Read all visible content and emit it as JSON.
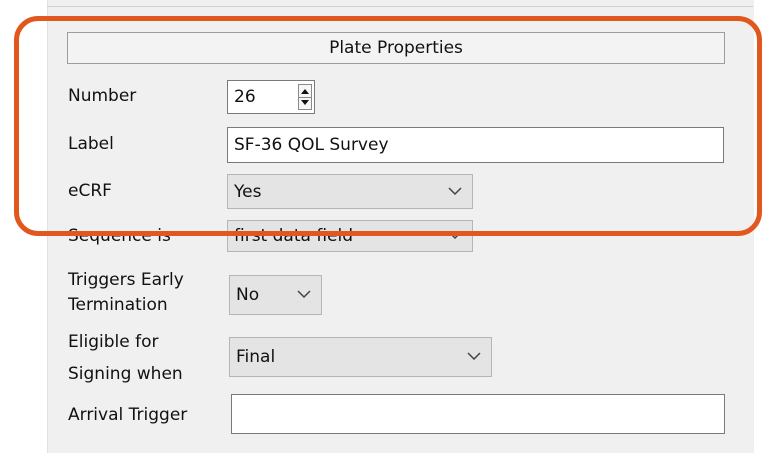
{
  "header": {
    "title": "Plate Properties"
  },
  "fields": {
    "number": {
      "label": "Number",
      "value": "26"
    },
    "label": {
      "label": "Label",
      "value": "SF-36 QOL Survey"
    },
    "ecrf": {
      "label": "eCRF",
      "value": "Yes"
    },
    "sequence": {
      "label": "Sequence is",
      "value": "first data field"
    },
    "triggers": {
      "label_line1": "Triggers Early",
      "label_line2": "Termination",
      "value": "No"
    },
    "eligible": {
      "label_line1": "Eligible for",
      "label_line2": "Signing when",
      "value": "Final"
    },
    "arrival": {
      "label": "Arrival Trigger",
      "value": ""
    }
  },
  "colors": {
    "highlight": "#e2571e",
    "panel": "#f0f0f0",
    "select_bg": "#e4e4e4"
  },
  "icons": {
    "dropdown": "chevron-down-icon",
    "spin_up": "spin-up-icon",
    "spin_down": "spin-down-icon"
  }
}
